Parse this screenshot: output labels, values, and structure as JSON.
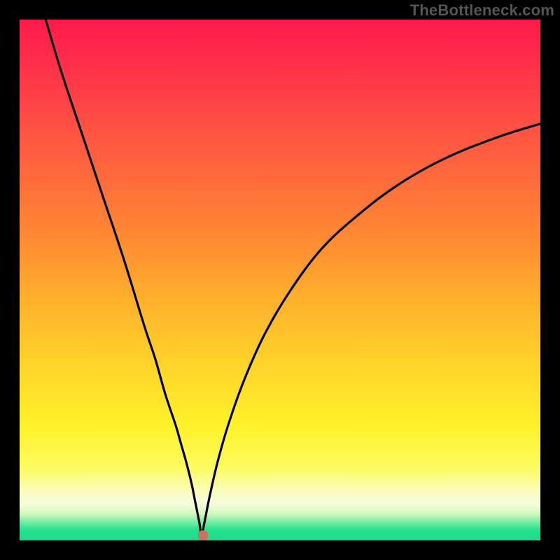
{
  "watermark": "TheBottleneck.com",
  "chart_data": {
    "type": "line",
    "title": "",
    "xlabel": "",
    "ylabel": "",
    "xlim": [
      0,
      100
    ],
    "ylim": [
      0,
      100
    ],
    "series": [
      {
        "name": "bottleneck-curve",
        "x": [
          5,
          8,
          12,
          16,
          20,
          24,
          26,
          28,
          30,
          31,
          32,
          33,
          33.7,
          34.5,
          34.9,
          35.5,
          36.5,
          38,
          40,
          43,
          47,
          52,
          58,
          65,
          73,
          82,
          92,
          100
        ],
        "values": [
          100,
          90,
          78,
          66,
          54,
          41,
          35,
          28,
          22,
          18.5,
          15,
          11,
          7.5,
          3.5,
          1.0,
          3.5,
          8.5,
          15,
          22,
          30.5,
          39.5,
          48,
          56,
          62.5,
          68.5,
          73.5,
          77.5,
          80
        ]
      }
    ],
    "marker": {
      "x": 35.2,
      "y": 0.9
    },
    "gradient_stops": [
      {
        "pos": 0,
        "color": "#ff1a4c"
      },
      {
        "pos": 0.55,
        "color": "#ffd62a"
      },
      {
        "pos": 0.86,
        "color": "#fdfb60"
      },
      {
        "pos": 1.0,
        "color": "#1fdb8d"
      }
    ]
  }
}
